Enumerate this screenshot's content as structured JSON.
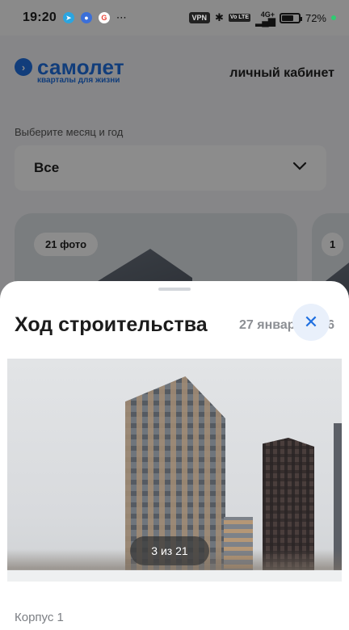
{
  "status_bar": {
    "time": "19:20",
    "vpn": "VPN",
    "volte": "Vo LTE",
    "network": "4G+",
    "battery_percent": "72%",
    "battery_level": 0.72,
    "notification_icons": [
      "telegram-icon",
      "chat-icon",
      "google-icon",
      "more-icon"
    ]
  },
  "header": {
    "logo_text": "самолет",
    "logo_tagline": "кварталы для жизни",
    "cabinet_link": "личный кабинет"
  },
  "filter": {
    "label": "Выберите месяц и год",
    "selected": "Все"
  },
  "cards": [
    {
      "photo_count": "21 фото"
    },
    {
      "photo_count": "1"
    }
  ],
  "sheet": {
    "title": "Ход строительства",
    "date": "27 января",
    "date_tail": "6",
    "image_counter": "3 из 21",
    "section_label": "Корпус 1"
  },
  "colors": {
    "brand": "#1f6fe0",
    "overlay": "rgba(0,0,0,0.45)"
  }
}
